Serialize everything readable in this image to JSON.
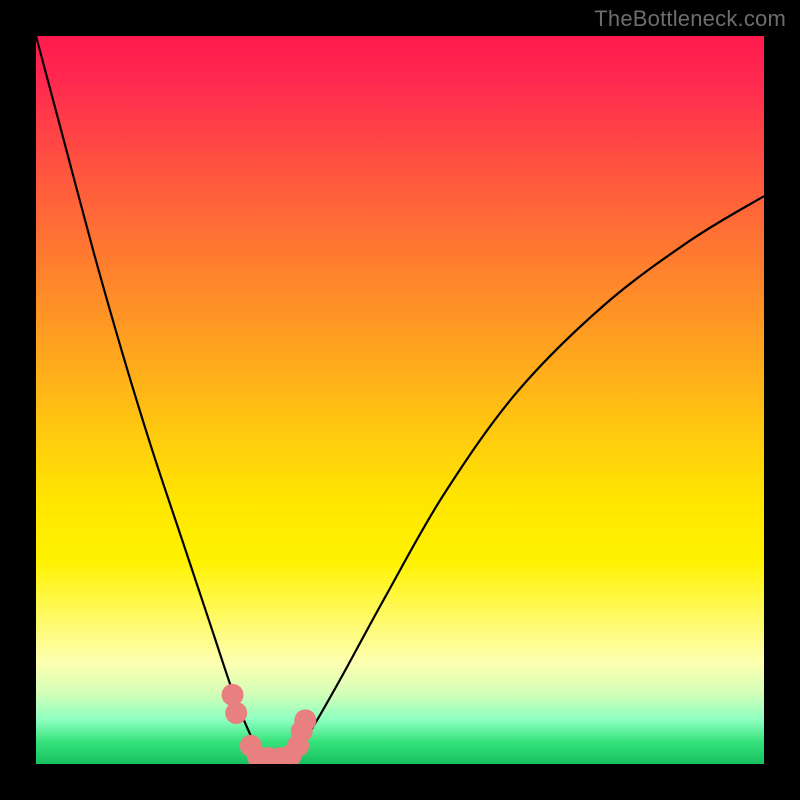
{
  "watermark": {
    "text": "TheBottleneck.com"
  },
  "chart_data": {
    "type": "line",
    "title": "",
    "xlabel": "",
    "ylabel": "",
    "xlim": [
      0,
      100
    ],
    "ylim": [
      0,
      100
    ],
    "series": [
      {
        "name": "bottleneck-curve",
        "x": [
          0,
          4,
          8,
          12,
          16,
          20,
          24,
          27,
          29,
          30.5,
          32,
          34,
          36,
          38,
          42,
          48,
          56,
          66,
          78,
          90,
          100
        ],
        "y": [
          100,
          85,
          70,
          56,
          43,
          31,
          19,
          10,
          5,
          2,
          0.5,
          0.5,
          2,
          5,
          12,
          23,
          37,
          51,
          63,
          72,
          78
        ]
      }
    ],
    "markers": {
      "name": "highlight-points",
      "color": "#e88080",
      "points": [
        {
          "x": 27.0,
          "y": 9.5
        },
        {
          "x": 27.5,
          "y": 7.0
        },
        {
          "x": 29.5,
          "y": 2.5
        },
        {
          "x": 30.5,
          "y": 1.0
        },
        {
          "x": 32.0,
          "y": 0.8
        },
        {
          "x": 33.5,
          "y": 0.8
        },
        {
          "x": 35.0,
          "y": 1.2
        },
        {
          "x": 36.0,
          "y": 2.5
        },
        {
          "x": 36.5,
          "y": 4.5
        },
        {
          "x": 37.0,
          "y": 6.0
        }
      ]
    },
    "background_gradient": {
      "top": "#ff1a4d",
      "mid": "#ffe600",
      "bottom": "#18c060"
    }
  }
}
